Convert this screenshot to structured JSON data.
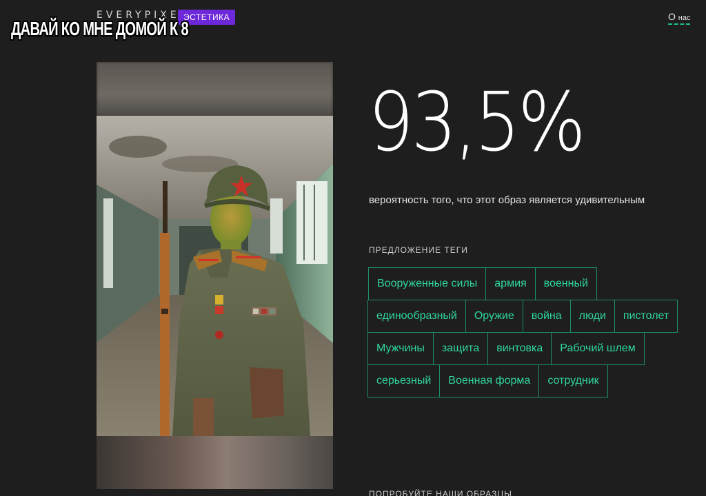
{
  "header": {
    "logo": "EVERYPIXEL",
    "badge": "ЭСТЕТИКА",
    "about_big": "О",
    "about_small": "нас"
  },
  "meme_caption": "ДАВАЙ КО МНЕ ДОМОЙ К 8",
  "result": {
    "score": "93,5%",
    "caption": "вероятность того, что этот образ является удивительным"
  },
  "tags_section": {
    "title": "ПРЕДЛОЖЕНИЕ ТЕГИ",
    "tags": [
      "Вооруженные силы",
      "армия",
      "военный",
      "единообразный",
      "Оружие",
      "война",
      "люди",
      "пистолет",
      "Мужчины",
      "защита",
      "винтовка",
      "Рабочий шлем",
      "серьезный",
      "Военная форма",
      "сотрудник"
    ]
  },
  "bottom_section": {
    "title": "ПОПРОБУЙТЕ НАШИ ОБРАЗЦЫ"
  },
  "colors": {
    "background": "#1e1e1e",
    "accent": "#2fd6a0",
    "badge": "#6d28d9"
  }
}
